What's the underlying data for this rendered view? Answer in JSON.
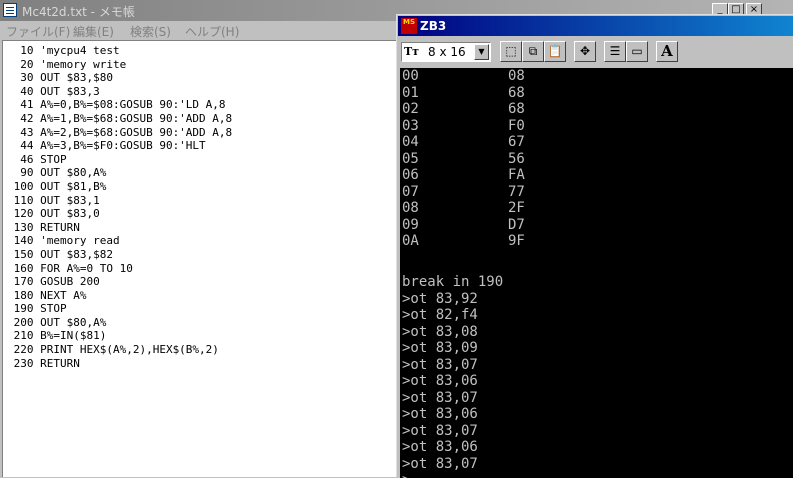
{
  "notepad": {
    "title": "Mc4t2d.txt - メモ帳",
    "menu": [
      "ファイル(F)",
      "編集(E)",
      "検索(S)",
      "ヘルプ(H)"
    ],
    "title_buttons": [
      "_",
      "□",
      "×"
    ],
    "lines": [
      "  10 'mycpu4 test",
      "  20 'memory write",
      "  30 OUT $83,$80",
      "  40 OUT $83,3",
      "  41 A%=0,B%=$08:GOSUB 90:'LD A,8",
      "  42 A%=1,B%=$68:GOSUB 90:'ADD A,8",
      "  43 A%=2,B%=$68:GOSUB 90:'ADD A,8",
      "  44 A%=3,B%=$F0:GOSUB 90:'HLT",
      "  46 STOP",
      "  90 OUT $80,A%",
      " 100 OUT $81,B%",
      " 110 OUT $83,1",
      " 120 OUT $83,0",
      " 130 RETURN",
      " 140 'memory read",
      " 150 OUT $83,$82",
      " 160 FOR A%=0 TO 10",
      " 170 GOSUB 200",
      " 180 NEXT A%",
      " 190 STOP",
      " 200 OUT $80,A%",
      " 210 B%=IN($81)",
      " 220 PRINT HEX$(A%,2),HEX$(B%,2)",
      " 230 RETURN"
    ]
  },
  "console": {
    "title": "ZB3",
    "icon_text": "MS",
    "font_prefix": "Tт",
    "font_size": "8 x 16",
    "toolbar": {
      "mark": "⬚",
      "copy": "⧉",
      "paste": "📋",
      "fullscreen": "✥",
      "properties": "☰",
      "background": "▭",
      "font": "A"
    },
    "memory_rows": [
      {
        "addr": "00",
        "val": "08"
      },
      {
        "addr": "01",
        "val": "68"
      },
      {
        "addr": "02",
        "val": "68"
      },
      {
        "addr": "03",
        "val": "F0"
      },
      {
        "addr": "04",
        "val": "67"
      },
      {
        "addr": "05",
        "val": "56"
      },
      {
        "addr": "06",
        "val": "FA"
      },
      {
        "addr": "07",
        "val": "77"
      },
      {
        "addr": "08",
        "val": "2F"
      },
      {
        "addr": "09",
        "val": "D7"
      },
      {
        "addr": "0A",
        "val": "9F"
      }
    ],
    "log": [
      "break in 190",
      ">ot 83,92",
      ">ot 82,f4",
      ">ot 83,08",
      ">ot 83,09",
      ">ot 83,07",
      ">ot 83,06",
      ">ot 83,07",
      ">ot 83,06",
      ">ot 83,07",
      ">ot 83,06",
      ">ot 83,07",
      ">"
    ]
  }
}
